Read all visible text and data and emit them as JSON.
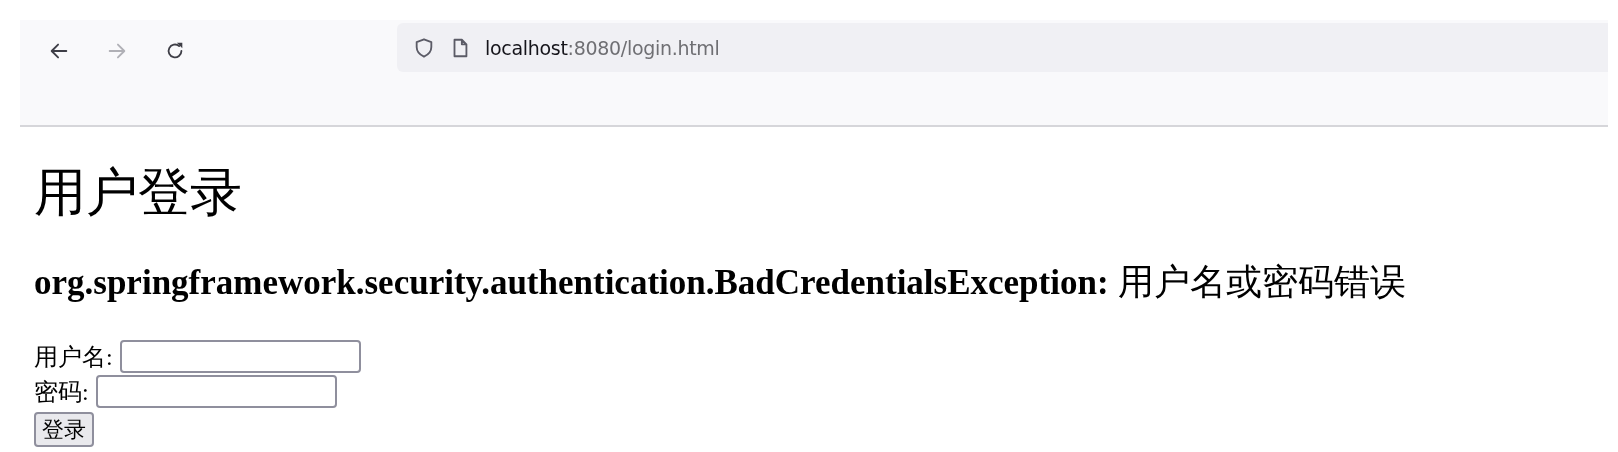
{
  "browser": {
    "nav_buttons": [
      {
        "kind": "back",
        "disabled": false
      },
      {
        "kind": "forward",
        "disabled": true
      },
      {
        "kind": "reload",
        "disabled": false
      }
    ],
    "address_bar": {
      "host": "localhost",
      "path": ":8080/login.html"
    }
  },
  "page": {
    "heading": "用户登录",
    "error": "**org.springframework.security.authentication.BadCredentialsException:** 用户名或密码错误",
    "fields": [
      {
        "label": "用户名:"
      },
      {
        "label": "密码:"
      }
    ],
    "submit_button": "登录"
  }
}
